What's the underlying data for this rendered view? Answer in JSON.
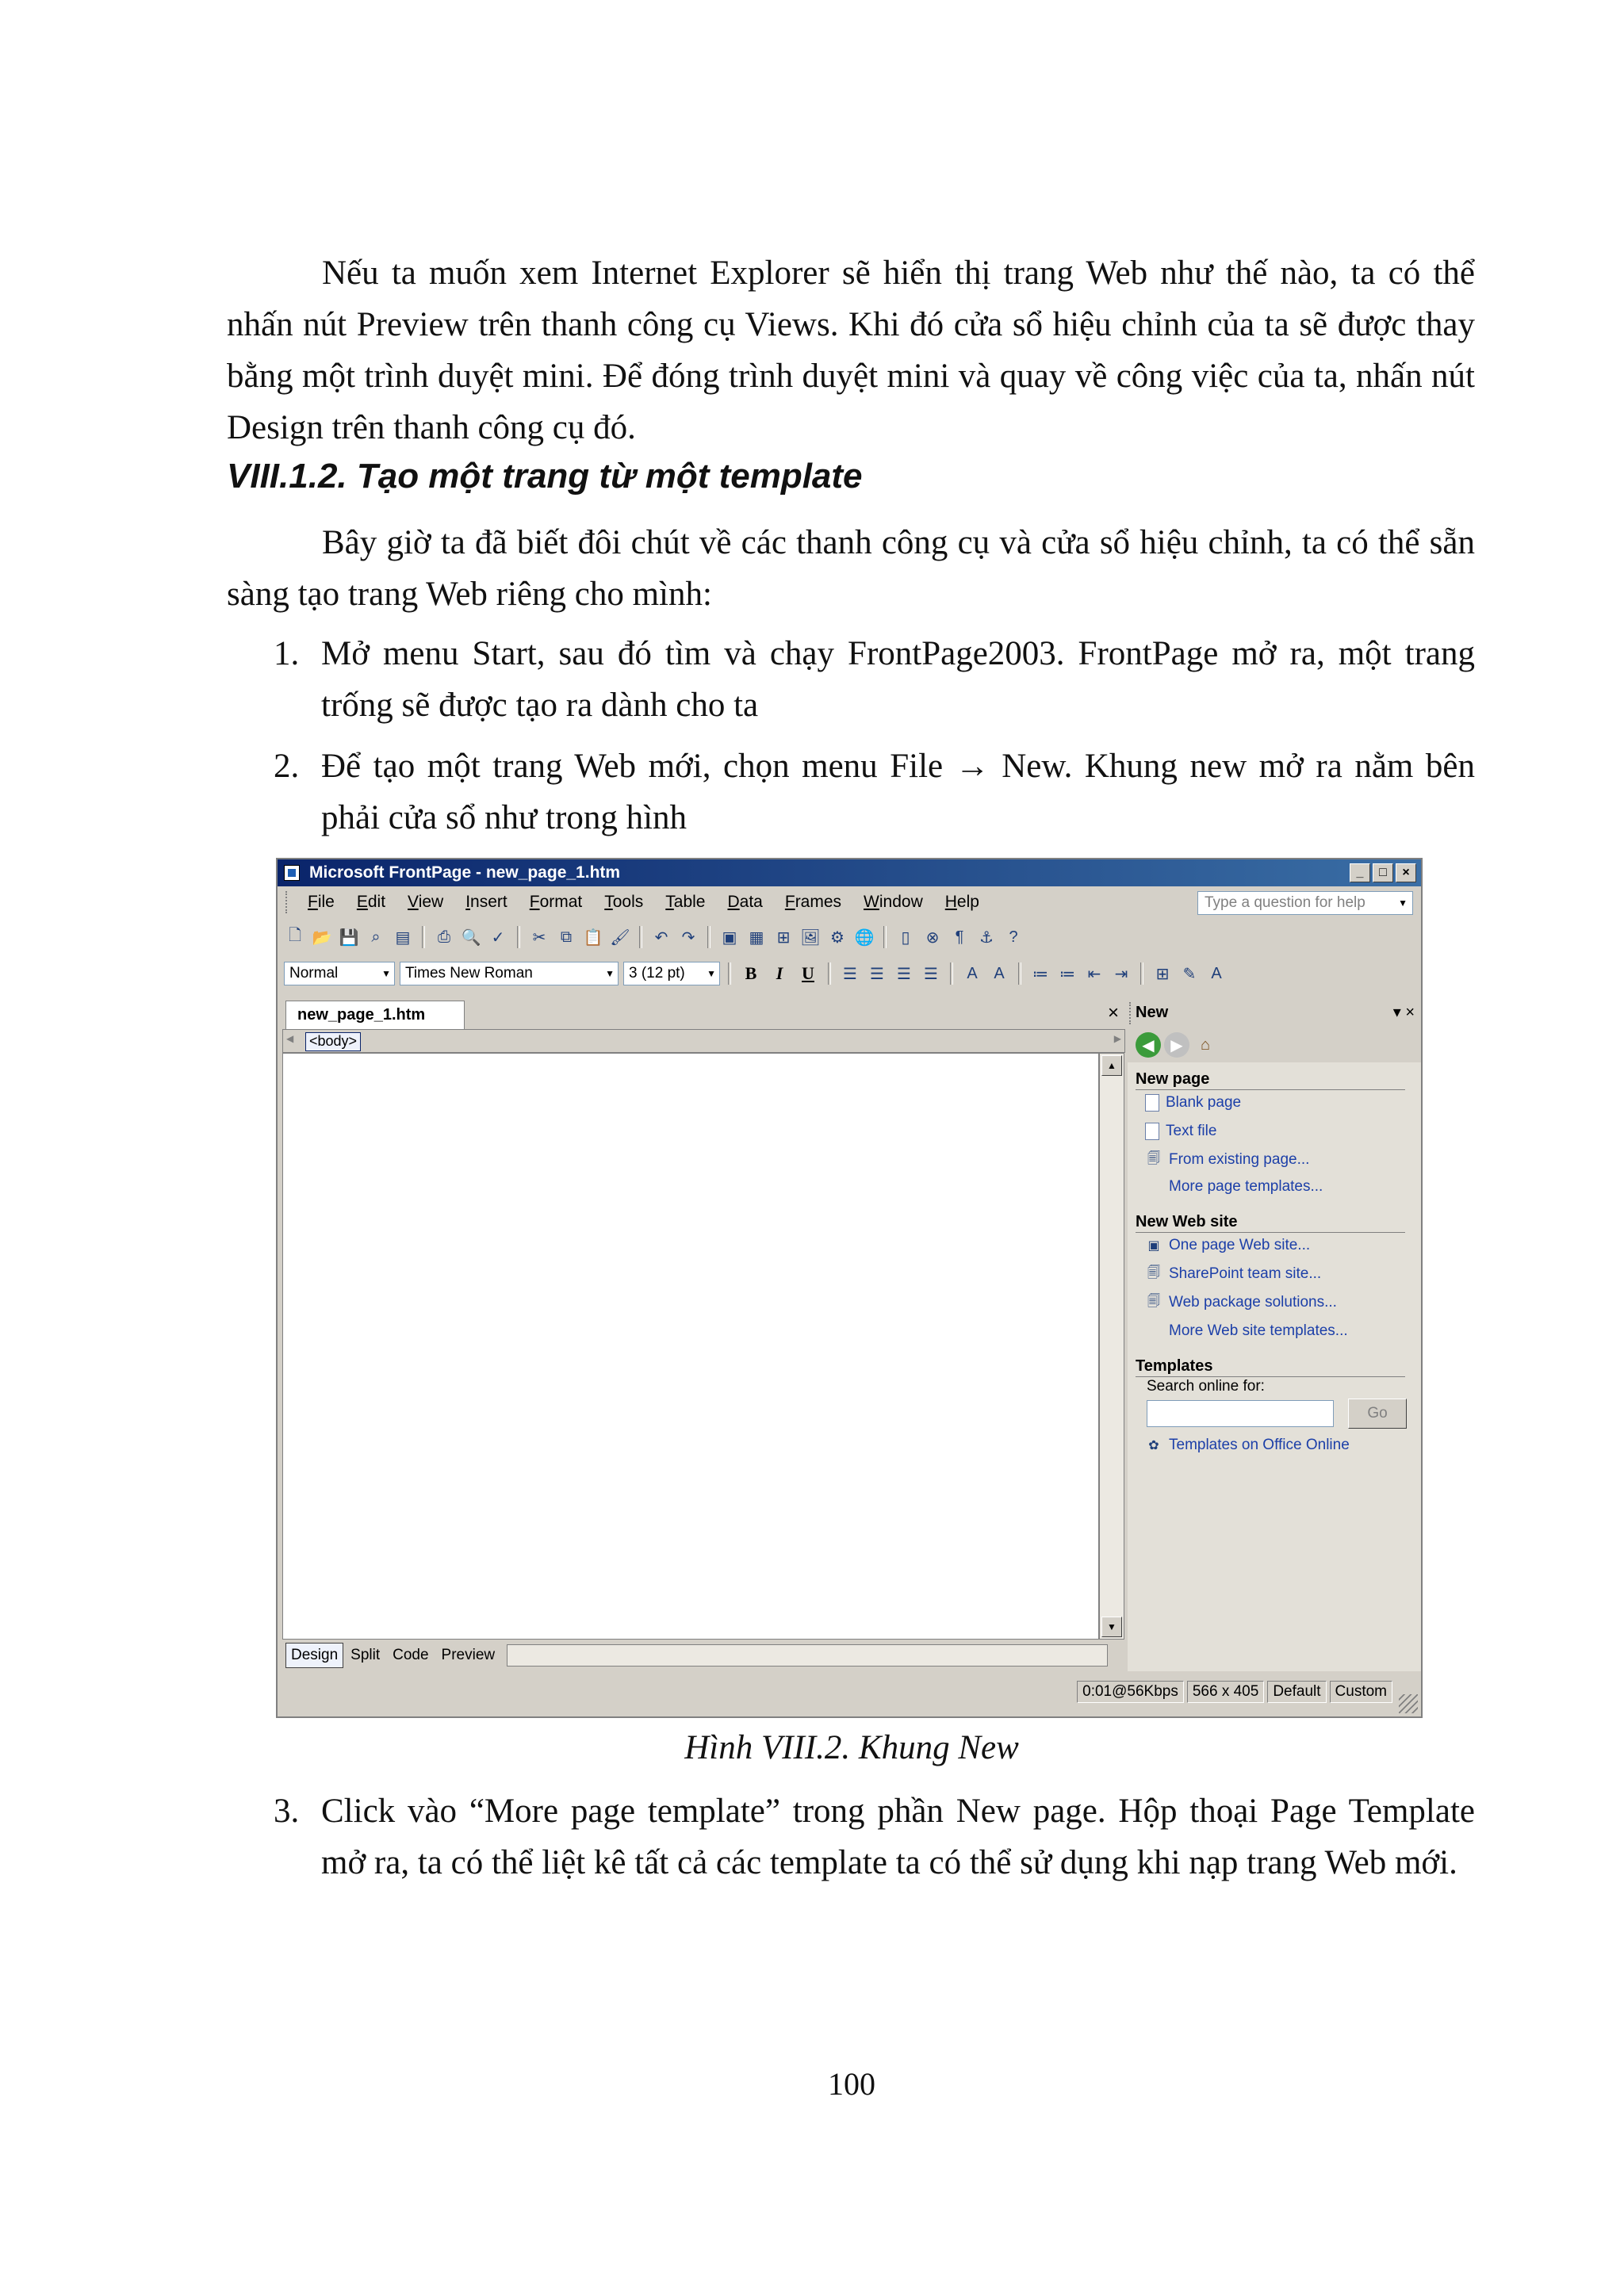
{
  "intro_paragraph": "Nếu ta muốn xem Internet Explorer sẽ hiển thị trang Web như thế nào, ta có thể nhấn nút Preview trên thanh công cụ Views. Khi đó cửa sổ hiệu chỉnh của ta sẽ được thay bằng một trình duyệt mini. Để đóng trình duyệt mini và quay về công việc của ta, nhấn nút Design trên thanh công cụ đó.",
  "section_heading": "VIII.1.2. Tạo một trang từ một template",
  "section_intro": "Bây giờ ta đã biết đôi chút về các thanh công cụ và cửa sổ hiệu chỉnh, ta có thể sẵn sàng tạo trang Web riêng cho mình:",
  "steps": [
    {
      "num": "1.",
      "text": "Mở menu Start, sau đó tìm và chạy FrontPage2003. FrontPage mở ra, một trang trống sẽ được tạo ra dành cho ta"
    },
    {
      "num": "2.",
      "text": "Để tạo một trang Web mới, chọn menu File → New. Khung new mở ra nằm bên phải cửa sổ như trong hình"
    },
    {
      "num": "3.",
      "text": "Click vào “More page template” trong phần New page. Hộp thoại Page Template mở ra, ta có thể liệt kê tất cả các template ta có thể sử dụng khi nạp trang Web mới."
    }
  ],
  "figure_caption": "Hình VIII.2. Khung New",
  "page_number": "100",
  "screenshot": {
    "title": "Microsoft FrontPage - new_page_1.htm",
    "menus": [
      "File",
      "Edit",
      "View",
      "Insert",
      "Format",
      "Tools",
      "Table",
      "Data",
      "Frames",
      "Window",
      "Help"
    ],
    "help_placeholder": "Type a question for help",
    "style_combo": "Normal",
    "font_combo": "Times New Roman",
    "size_combo": "3 (12 pt)",
    "doc_tab": "new_page_1.htm",
    "tag": "<body>",
    "views": [
      "Design",
      "Split",
      "Code",
      "Preview"
    ],
    "task_pane": {
      "title": "New",
      "new_page_heading": "New page",
      "new_page_links": [
        "Blank page",
        "Text file",
        "From existing page...",
        "More page templates..."
      ],
      "new_site_heading": "New Web site",
      "new_site_links": [
        "One page Web site...",
        "SharePoint team site...",
        "Web package solutions...",
        "More Web site templates..."
      ],
      "templates_heading": "Templates",
      "search_label": "Search online for:",
      "go_label": "Go",
      "online_link": "Templates on Office Online"
    },
    "status": [
      "0:01@56Kbps",
      "566 x 405",
      "Default",
      "Custom"
    ]
  }
}
